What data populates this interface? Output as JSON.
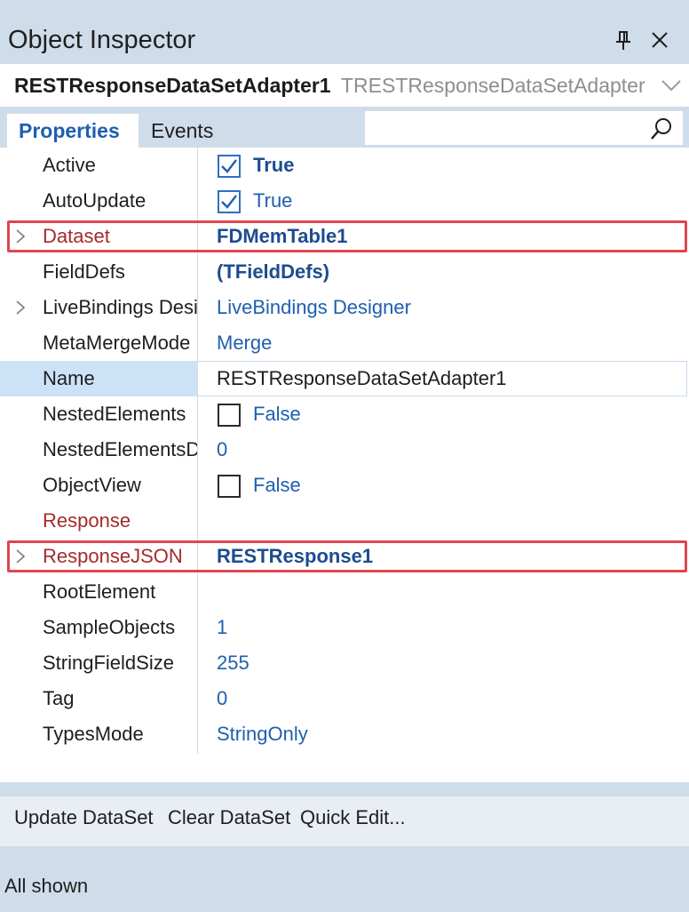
{
  "window": {
    "title": "Object Inspector"
  },
  "selector": {
    "component_name": "RESTResponseDataSetAdapter1",
    "component_type": "TRESTResponseDataSetAdapter"
  },
  "tabs": [
    {
      "label": "Properties",
      "active": true
    },
    {
      "label": "Events",
      "active": false
    }
  ],
  "search": {
    "value": "",
    "placeholder": ""
  },
  "properties": [
    {
      "name": "Active",
      "value": "True",
      "checkbox": true,
      "checked": true,
      "style": "bold"
    },
    {
      "name": "AutoUpdate",
      "value": "True",
      "checkbox": true,
      "checked": true,
      "style": "blue"
    },
    {
      "name": "Dataset",
      "value": "FDMemTable1",
      "expandable": true,
      "highlighted": true,
      "name_color": "red",
      "style": "bold"
    },
    {
      "name": "FieldDefs",
      "value": "(TFieldDefs)",
      "style": "bold"
    },
    {
      "name": "LiveBindings Designer",
      "value": "LiveBindings Designer",
      "expandable": true,
      "style": "blue"
    },
    {
      "name": "MetaMergeMode",
      "value": "Merge",
      "style": "blue"
    },
    {
      "name": "Name",
      "value": "RESTResponseDataSetAdapter1",
      "selected": true,
      "style": "plain"
    },
    {
      "name": "NestedElements",
      "value": "False",
      "checkbox": true,
      "checked": false,
      "style": "blue"
    },
    {
      "name": "NestedElementsDepth",
      "value": "0",
      "style": "blue"
    },
    {
      "name": "ObjectView",
      "value": "False",
      "checkbox": true,
      "checked": false,
      "style": "blue"
    },
    {
      "name": "Response",
      "value": "",
      "name_color": "red",
      "style": "blue"
    },
    {
      "name": "ResponseJSON",
      "value": "RESTResponse1",
      "expandable": true,
      "highlighted": true,
      "name_color": "red",
      "style": "bold"
    },
    {
      "name": "RootElement",
      "value": "",
      "style": "blue"
    },
    {
      "name": "SampleObjects",
      "value": "1",
      "style": "blue"
    },
    {
      "name": "StringFieldSize",
      "value": "255",
      "style": "blue"
    },
    {
      "name": "Tag",
      "value": "0",
      "style": "blue"
    },
    {
      "name": "TypesMode",
      "value": "StringOnly",
      "style": "blue"
    }
  ],
  "actions": {
    "update_dataset": "Update DataSet",
    "clear_dataset": "Clear DataSet",
    "quick_edit": "Quick Edit..."
  },
  "status": {
    "text": "All shown"
  },
  "colors": {
    "title_bg": "#cfdcea",
    "accent_blue": "#1f5fb0",
    "highlight_red": "#e0454f",
    "selected_row": "#cce3f7"
  }
}
